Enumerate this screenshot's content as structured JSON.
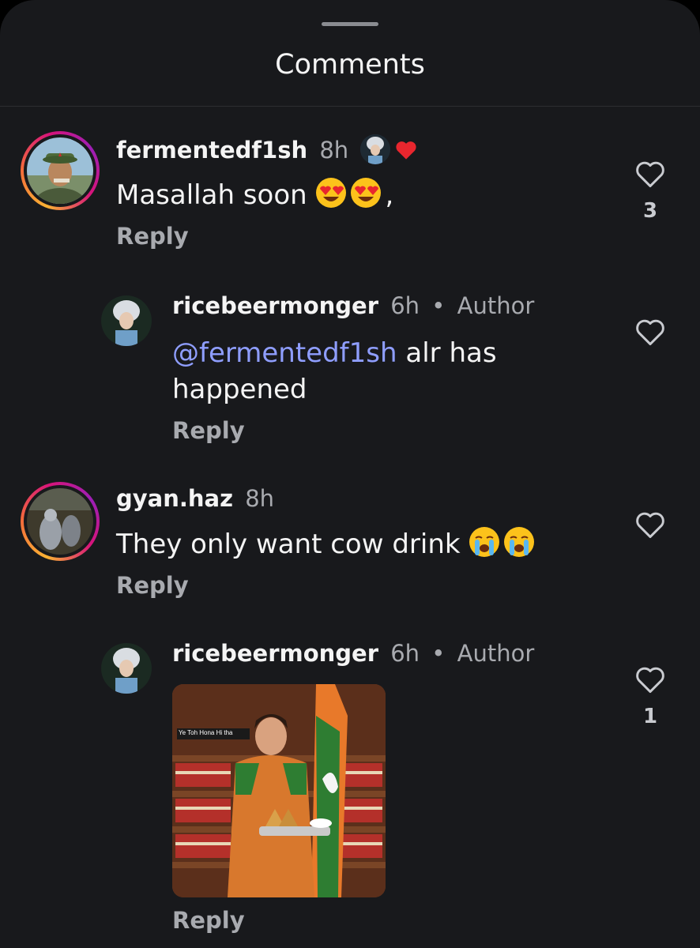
{
  "header": {
    "title": "Comments"
  },
  "comments": [
    {
      "username": "fermentedf1sh",
      "time": "8h",
      "text": "Masallah soon",
      "trailing": ",",
      "emoji": [
        "smiling-face-with-heart-eyes",
        "smiling-face-with-heart-eyes"
      ],
      "reply_label": "Reply",
      "like_count": "3"
    },
    {
      "username": "ricebeermonger",
      "time": "6h",
      "badge": "Author",
      "mention": "@fermentedf1sh",
      "text": " alr has happened",
      "reply_label": "Reply"
    },
    {
      "username": "gyan.haz",
      "time": "8h",
      "text": "They only want cow drink",
      "emoji": [
        "loudly-crying-face",
        "loudly-crying-face"
      ],
      "reply_label": "Reply"
    },
    {
      "username": "ricebeermonger",
      "time": "6h",
      "badge": "Author",
      "image_caption": "Ye Toh Hona Hi tha",
      "reply_label": "Reply",
      "like_count": "1"
    }
  ],
  "colors": {
    "background": "#18191c",
    "text": "#f4f4f4",
    "muted": "#a8aaaf",
    "mention": "#8f9eff",
    "heart": "#e8262e"
  }
}
